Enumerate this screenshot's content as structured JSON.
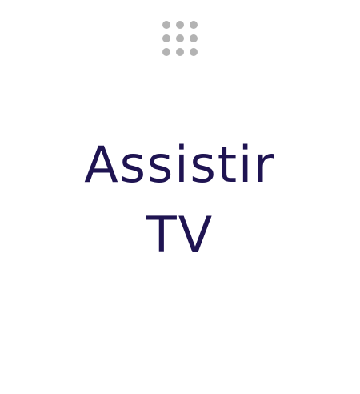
{
  "tile": {
    "title_line_1": "Assistir",
    "title_line_2": "TV",
    "drag_handle_icon": "grid-dots-icon"
  },
  "colors": {
    "background": "#ffffff",
    "title": "#1f1452",
    "handle_dots": "#b3b3b3"
  }
}
